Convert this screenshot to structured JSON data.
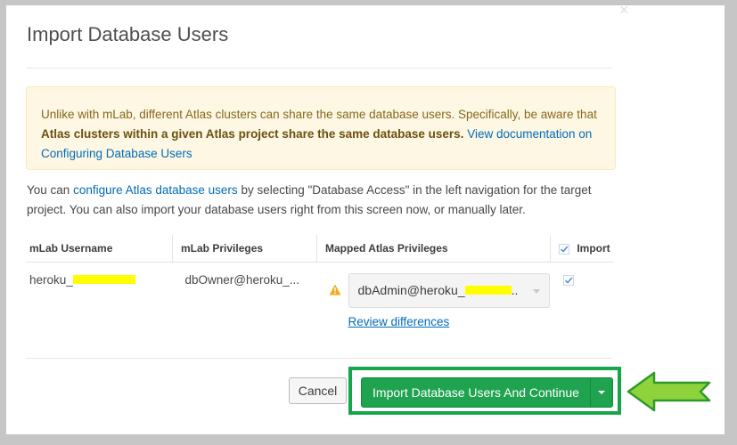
{
  "modal": {
    "title": "Import Database Users",
    "close_glyph": "×"
  },
  "notice": {
    "text_before": "Unlike with mLab, different Atlas clusters can share the same database users. Specifically, be aware that ",
    "bold": "Atlas clusters within a given Atlas project share the same database users.",
    "link": "View documentation on Configuring Database Users"
  },
  "info": {
    "text_before": "You can ",
    "link": "configure Atlas database users",
    "text_after": " by selecting \"Database Access\" in the left navigation for the target project. You can also import your database users right from this screen now, or manually later."
  },
  "table": {
    "headers": {
      "username": "mLab Username",
      "privileges": "mLab Privileges",
      "mapped": "Mapped Atlas Privileges",
      "import": "Import"
    },
    "rows": [
      {
        "username": "heroku_",
        "privileges": "dbOwner@heroku_...",
        "mapped": "dbAdmin@heroku_",
        "mapped_suffix": "..",
        "review_link": "Review differences",
        "import_checked": true
      }
    ]
  },
  "footer": {
    "cancel_label": "Cancel",
    "primary_label": "Import Database Users And Continue"
  },
  "colors": {
    "primary": "#1fa34f",
    "highlight": "#15a54b",
    "arrow_fill": "#8fd33c",
    "redaction": "#ffff00",
    "link": "#006cbc"
  }
}
